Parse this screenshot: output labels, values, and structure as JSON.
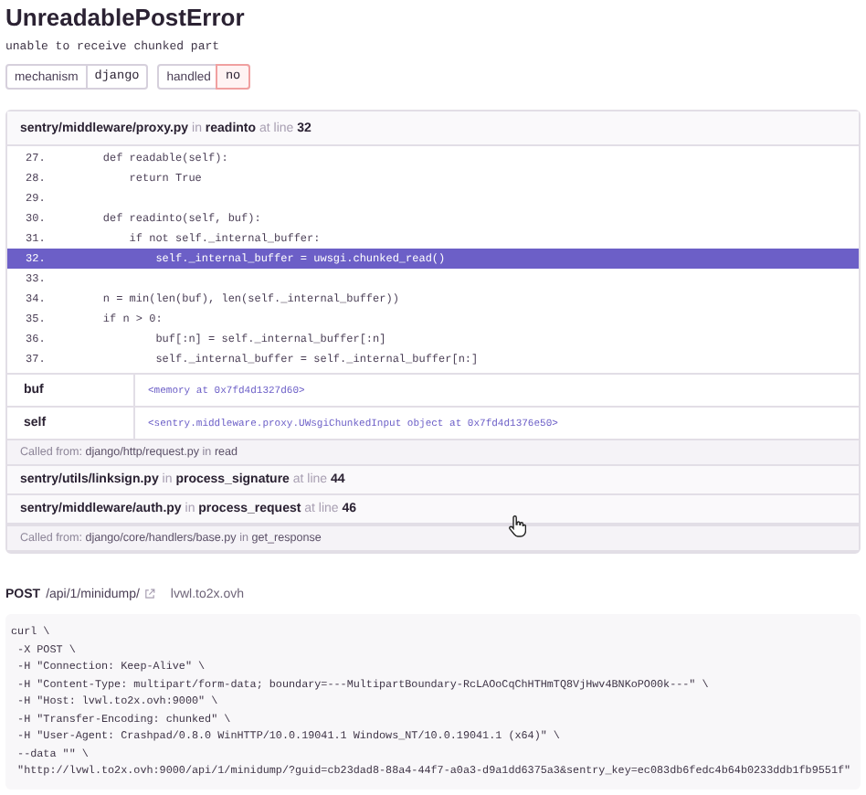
{
  "title": "UnreadablePostError",
  "message": "unable to receive chunked part",
  "tags": [
    {
      "key": "mechanism",
      "value": "django",
      "kind": "neutral"
    },
    {
      "key": "handled",
      "value": "no",
      "kind": "error"
    }
  ],
  "frames": [
    {
      "file": "sentry/middleware/proxy.py",
      "in": "in",
      "function": "readinto",
      "at": "at line",
      "line": "32",
      "expanded": true,
      "context": [
        {
          "number": "27.",
          "code": "    def readable(self):",
          "selected": false
        },
        {
          "number": "28.",
          "code": "        return True",
          "selected": false
        },
        {
          "number": "29.",
          "selected": false
        },
        {
          "number": "30.",
          "code": "    def readinto(self, buf):",
          "selected": false
        },
        {
          "number": "31.",
          "code": "        if not self._internal_buffer:",
          "selected": false
        },
        {
          "number": "32.",
          "code": "            self._internal_buffer = uwsgi.chunked_read()",
          "selected": true
        },
        {
          "number": "33.",
          "selected": false
        },
        {
          "number": "34.",
          "code": "    n = min(len(buf), len(self._internal_buffer))",
          "selected": false
        },
        {
          "number": "35.",
          "code": "    if n > 0:",
          "selected": false
        },
        {
          "number": "36.",
          "code": "            buf[:n] = self._internal_buffer[:n]",
          "selected": false
        },
        {
          "number": "37.",
          "code": "            self._internal_buffer = self._internal_buffer[n:]",
          "selected": false
        }
      ],
      "vars": [
        {
          "name": "buf",
          "value": "<memory at 0x7fd4d1327d60>"
        },
        {
          "name": "self",
          "value": "<sentry.middleware.proxy.UWsgiChunkedInput object at 0x7fd4d1376e50>"
        }
      ],
      "called_from": {
        "label": "Called from:",
        "file": "django/http/request.py",
        "in": "in",
        "function": "read"
      }
    },
    {
      "file": "sentry/utils/linksign.py",
      "in": "in",
      "function": "process_signature",
      "at": "at line",
      "line": "44",
      "expanded": false
    },
    {
      "file": "sentry/middleware/auth.py",
      "in": "in",
      "function": "process_request",
      "at": "at line",
      "line": "46",
      "expanded": false,
      "called_from": {
        "label": "Called from:",
        "file": "django/core/handlers/base.py",
        "in": "in",
        "function": "get_response"
      }
    }
  ],
  "request": {
    "method": "POST",
    "path": "/api/1/minidump/",
    "host": "lvwl.to2x.ovh",
    "curl": [
      "curl \\",
      " -X POST \\",
      " -H \"Connection: Keep-Alive\" \\",
      " -H \"Content-Type: multipart/form-data; boundary=---MultipartBoundary-RcLAOoCqChHTHmTQ8VjHwv4BNKoPO00k---\" \\",
      " -H \"Host: lvwl.to2x.ovh:9000\" \\",
      " -H \"Transfer-Encoding: chunked\" \\",
      " -H \"User-Agent: Crashpad/0.8.0 WinHTTP/10.0.19041.1 Windows_NT/10.0.19041.1 (x64)\" \\",
      " --data \"\" \\",
      " \"http://lvwl.to2x.ovh:9000/api/1/minidump/?guid=cb23dad8-88a4-44f7-a0a3-d9a1dd6375a3&sentry_key=ec083db6fedc4b64b0233ddb1fb9551f\""
    ]
  }
}
